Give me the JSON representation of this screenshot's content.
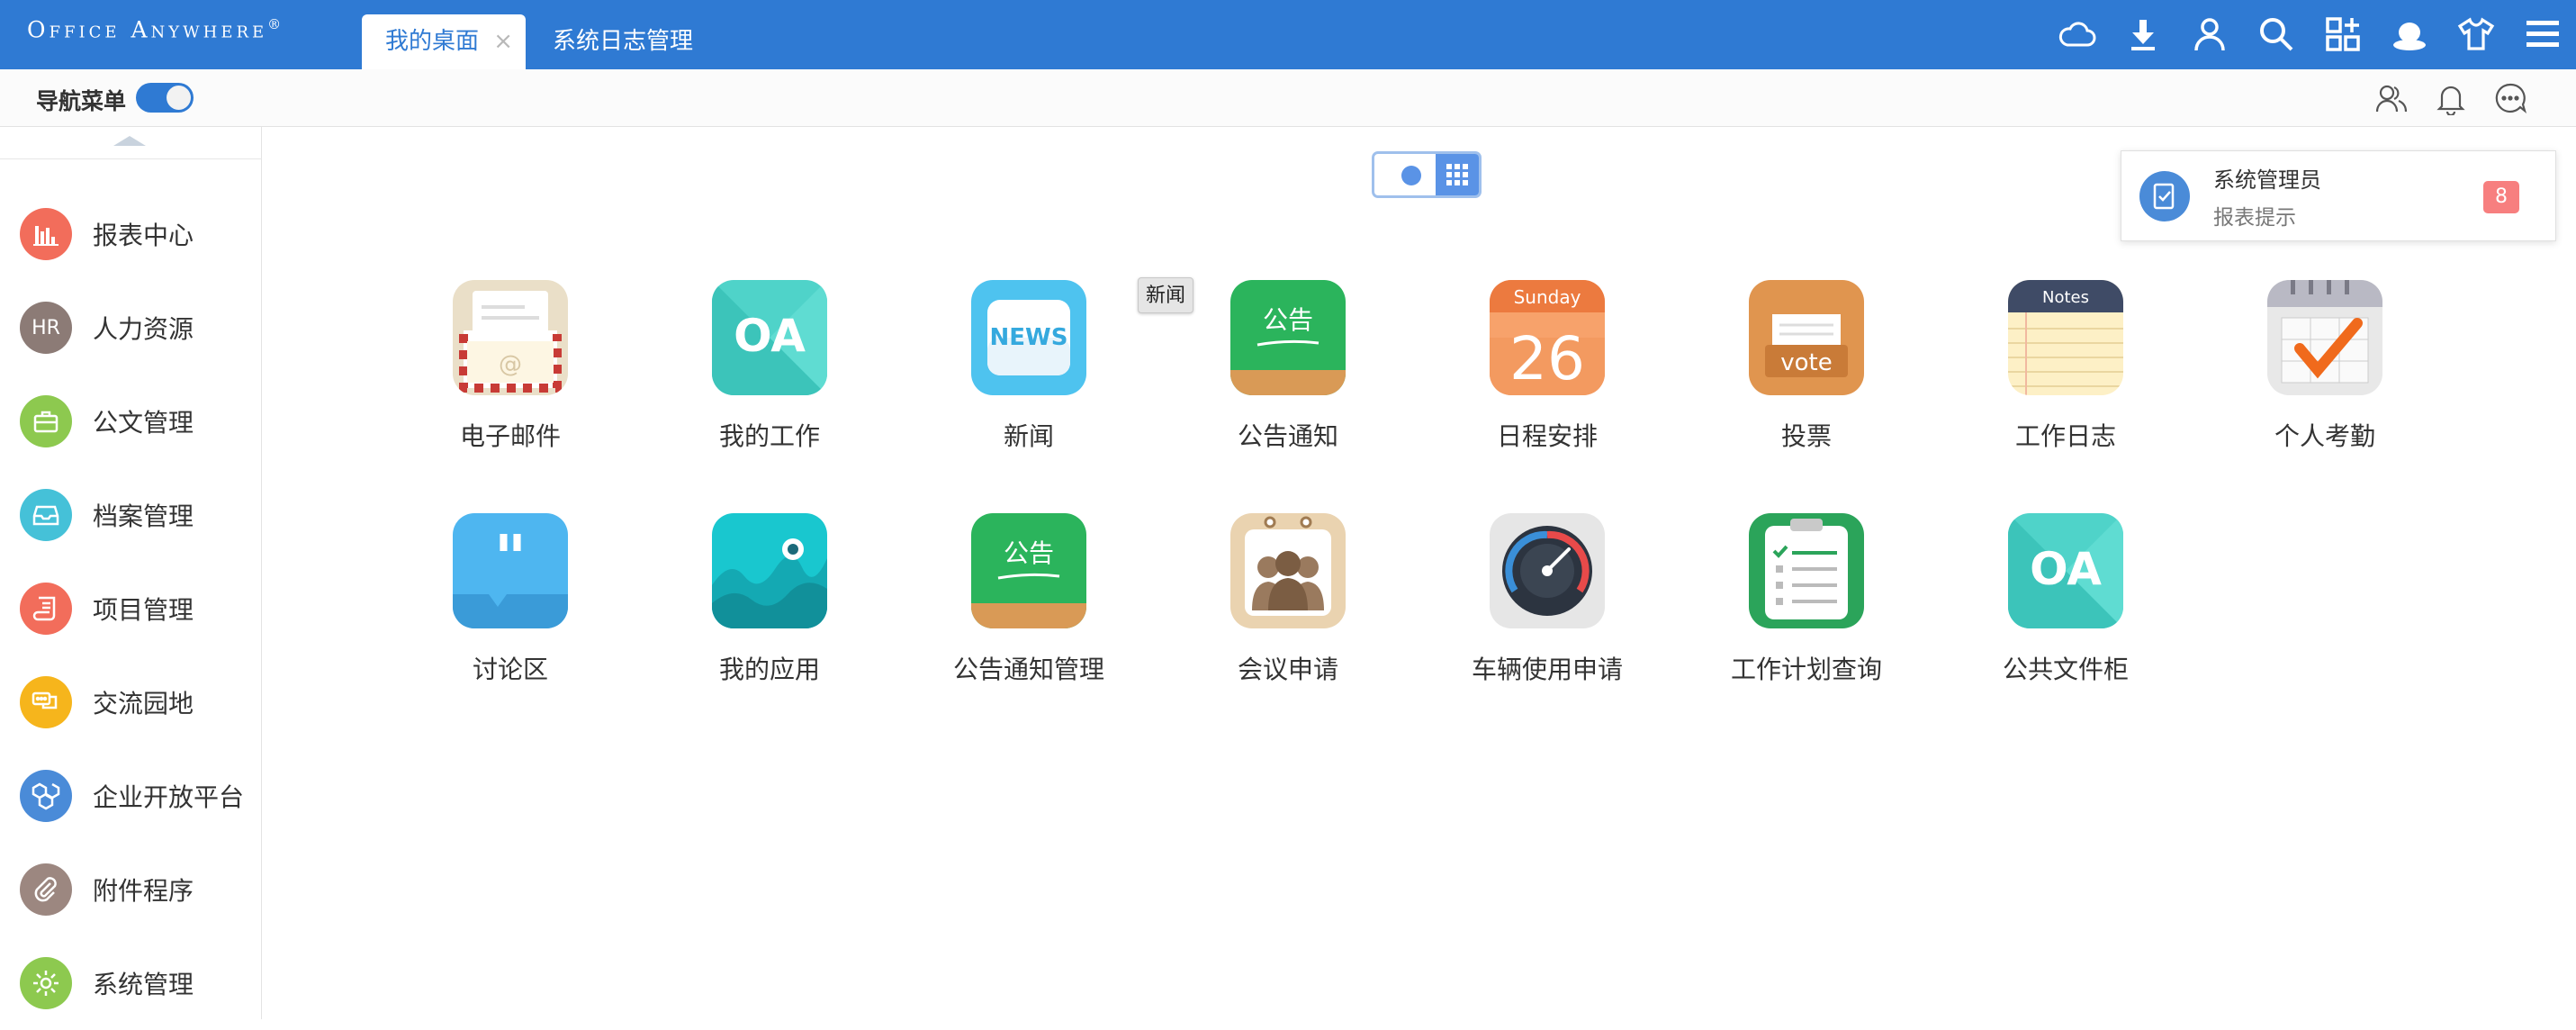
{
  "app": {
    "logo_text": "Office Anywhere",
    "logo_mark": "®"
  },
  "tabs": [
    {
      "label": "我的桌面",
      "close": "×",
      "active": true
    },
    {
      "label": "系统日志管理",
      "active": false
    }
  ],
  "top_icons": [
    "cloud-icon",
    "download-icon",
    "user-icon",
    "search-icon",
    "apps-grid-icon",
    "skin-icon",
    "theme-shirt-icon",
    "menu-icon"
  ],
  "subbar": {
    "nav_menu_label": "导航菜单",
    "nav_menu_toggle_on": true,
    "icons": [
      "contacts-icon",
      "bell-icon",
      "chat-icon"
    ]
  },
  "sidebar": {
    "items": [
      {
        "label": "报表中心",
        "icon": "report-chart-icon",
        "color": "#f26d5b"
      },
      {
        "label": "人力资源",
        "icon": "hr-icon",
        "icon_text": "HR",
        "color": "#8c7b76"
      },
      {
        "label": "公文管理",
        "icon": "briefcase-icon",
        "color": "#8dc94f"
      },
      {
        "label": "档案管理",
        "icon": "archive-box-icon",
        "color": "#45c1d8"
      },
      {
        "label": "项目管理",
        "icon": "project-scroll-icon",
        "color": "#f26d5b"
      },
      {
        "label": "交流园地",
        "icon": "chat-bubbles-icon",
        "color": "#f6b51c"
      },
      {
        "label": "企业开放平台",
        "icon": "cubes-icon",
        "color": "#4a8bd8"
      },
      {
        "label": "附件程序",
        "icon": "paperclip-icon",
        "color": "#9c8780"
      },
      {
        "label": "系统管理",
        "icon": "settings-gear-icon",
        "color": "#8dc94f"
      }
    ]
  },
  "apps": [
    {
      "label": "电子邮件",
      "icon": "email-envelope-icon"
    },
    {
      "label": "我的工作",
      "icon": "oa-icon",
      "icon_text": "OA"
    },
    {
      "label": "新闻",
      "icon": "news-icon",
      "icon_text": "NEWS"
    },
    {
      "label": "公告通知",
      "icon": "notice-board-icon",
      "icon_text": "公告"
    },
    {
      "label": "日程安排",
      "icon": "calendar-icon",
      "icon_day": "Sunday",
      "icon_date": "26"
    },
    {
      "label": "投票",
      "icon": "vote-box-icon",
      "icon_text": "vote"
    },
    {
      "label": "工作日志",
      "icon": "notes-pad-icon",
      "icon_text": "Notes"
    },
    {
      "label": "个人考勤",
      "icon": "attendance-check-icon"
    },
    {
      "label": "讨论区",
      "icon": "discussion-quote-icon"
    },
    {
      "label": "我的应用",
      "icon": "my-apps-wave-icon"
    },
    {
      "label": "公告通知管理",
      "icon": "notice-board-icon",
      "icon_text": "公告"
    },
    {
      "label": "会议申请",
      "icon": "meeting-people-icon"
    },
    {
      "label": "车辆使用申请",
      "icon": "speedometer-icon"
    },
    {
      "label": "工作计划查询",
      "icon": "clipboard-plan-icon"
    },
    {
      "label": "公共文件柜",
      "icon": "oa-icon",
      "icon_text": "OA"
    }
  ],
  "tooltip": "新闻",
  "notification": {
    "title": "系统管理员",
    "subtitle": "报表提示",
    "count": "8"
  }
}
